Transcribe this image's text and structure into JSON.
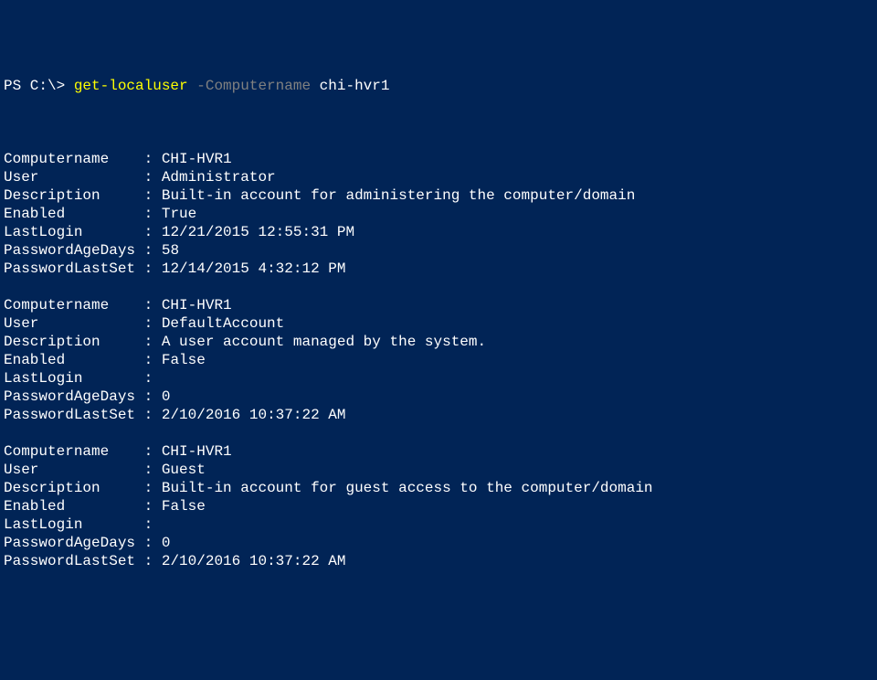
{
  "prompt": {
    "prefix": "PS C:\\> ",
    "command": "get-localuser",
    "param_flag": " -Computername",
    "arg": " chi-hvr1"
  },
  "labels": {
    "Computername": "Computername",
    "User": "User",
    "Description": "Description",
    "Enabled": "Enabled",
    "LastLogin": "LastLogin",
    "PasswordAgeDays": "PasswordAgeDays",
    "PasswordLastSet": "PasswordLastSet"
  },
  "records": [
    {
      "Computername": "CHI-HVR1",
      "User": "Administrator",
      "Description": "Built-in account for administering the computer/domain",
      "Enabled": "True",
      "LastLogin": "12/21/2015 12:55:31 PM",
      "PasswordAgeDays": "58",
      "PasswordLastSet": "12/14/2015 4:32:12 PM"
    },
    {
      "Computername": "CHI-HVR1",
      "User": "DefaultAccount",
      "Description": "A user account managed by the system.",
      "Enabled": "False",
      "LastLogin": "",
      "PasswordAgeDays": "0",
      "PasswordLastSet": "2/10/2016 10:37:22 AM"
    },
    {
      "Computername": "CHI-HVR1",
      "User": "Guest",
      "Description": "Built-in account for guest access to the computer/domain",
      "Enabled": "False",
      "LastLogin": "",
      "PasswordAgeDays": "0",
      "PasswordLastSet": "2/10/2016 10:37:22 AM"
    }
  ]
}
